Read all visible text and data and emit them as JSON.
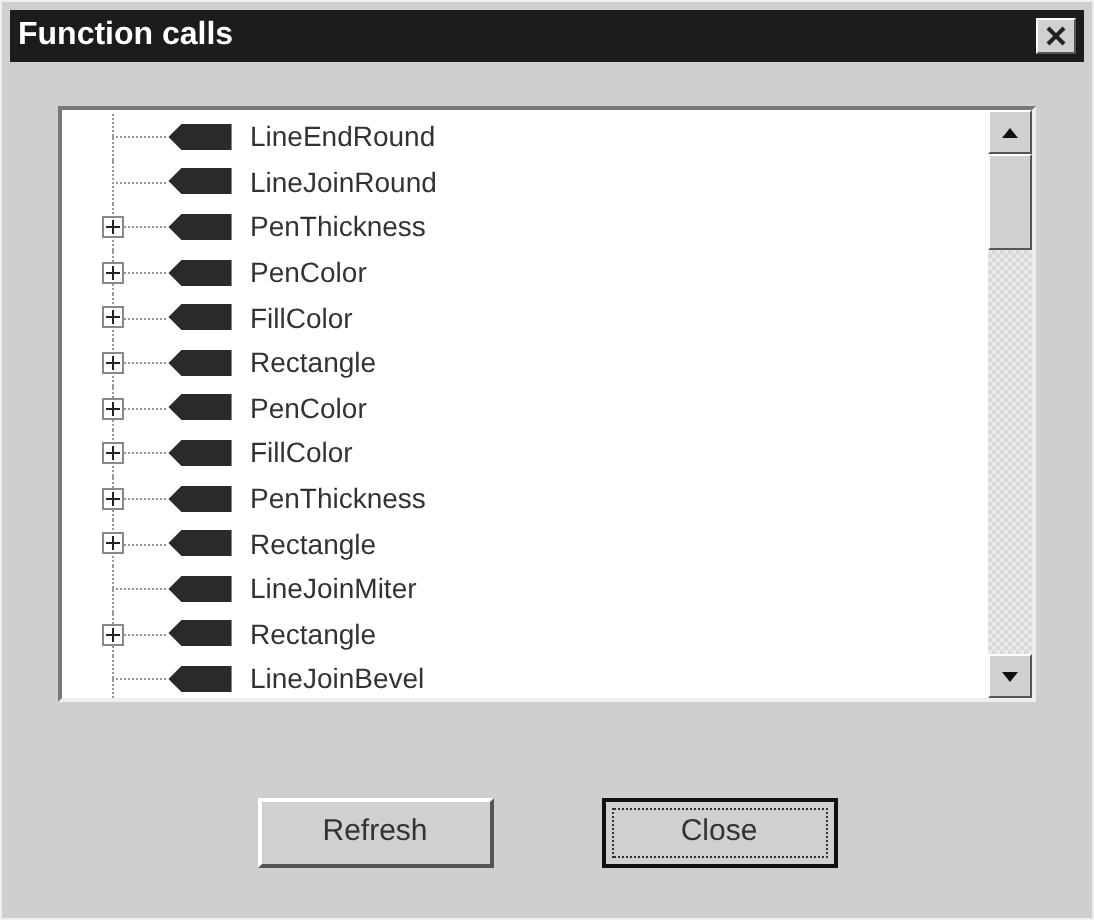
{
  "window": {
    "title": "Function calls"
  },
  "tree": {
    "items": [
      {
        "label": "LineEndRound",
        "kind": "leaf"
      },
      {
        "label": "LineJoinRound",
        "kind": "leaf"
      },
      {
        "label": "PenThickness",
        "kind": "collapsed"
      },
      {
        "label": "PenColor",
        "kind": "collapsed"
      },
      {
        "label": "FillColor",
        "kind": "collapsed"
      },
      {
        "label": "Rectangle",
        "kind": "collapsed"
      },
      {
        "label": "PenColor",
        "kind": "collapsed"
      },
      {
        "label": "FillColor",
        "kind": "collapsed"
      },
      {
        "label": "PenThickness",
        "kind": "collapsed"
      },
      {
        "label": "Rectangle",
        "kind": "collapsed"
      },
      {
        "label": "LineJoinMiter",
        "kind": "leaf"
      },
      {
        "label": "Rectangle",
        "kind": "collapsed"
      },
      {
        "label": "LineJoinBevel",
        "kind": "leaf"
      }
    ]
  },
  "buttons": [
    {
      "label": "Refresh",
      "focused": false
    },
    {
      "label": "Close",
      "focused": true
    }
  ]
}
